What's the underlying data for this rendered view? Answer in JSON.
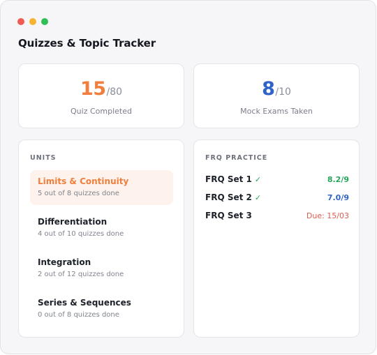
{
  "window": {
    "controls": [
      {
        "name": "close",
        "color": "#f05b53"
      },
      {
        "name": "minimize",
        "color": "#f6b431"
      },
      {
        "name": "maximize",
        "color": "#2fbf57"
      }
    ]
  },
  "title": "Quizzes & Topic Tracker",
  "stats": {
    "quizzes": {
      "value": "15",
      "total": "/80",
      "label": "Quiz Completed",
      "color": "#f07e3c"
    },
    "mock_exams": {
      "value": "8",
      "total": "/10",
      "label": "Mock Exams Taken",
      "color": "#2f63c9"
    }
  },
  "units": {
    "heading": "UNITS",
    "items": [
      {
        "name": "Limits & Continuity",
        "progress": "5 out of 8 quizzes done",
        "active": true
      },
      {
        "name": "Differentiation",
        "progress": "4 out of 10 quizzes done",
        "active": false
      },
      {
        "name": "Integration",
        "progress": "2 out of 12 quizzes done",
        "active": false
      },
      {
        "name": "Series & Sequences",
        "progress": "0 out of 8 quizzes done",
        "active": false
      }
    ]
  },
  "frq": {
    "heading": "FRQ PRACTICE",
    "check_icon": "check-icon",
    "items": [
      {
        "name": "FRQ Set 1",
        "completed": true,
        "result": "8.2/9",
        "result_color": "#26a65b"
      },
      {
        "name": "FRQ Set 2",
        "completed": true,
        "result": "7.0/9",
        "result_color": "#2f63c9"
      },
      {
        "name": "FRQ Set 3",
        "completed": false,
        "result": "Due: 15/03",
        "result_color": "#e05a4e"
      }
    ]
  }
}
